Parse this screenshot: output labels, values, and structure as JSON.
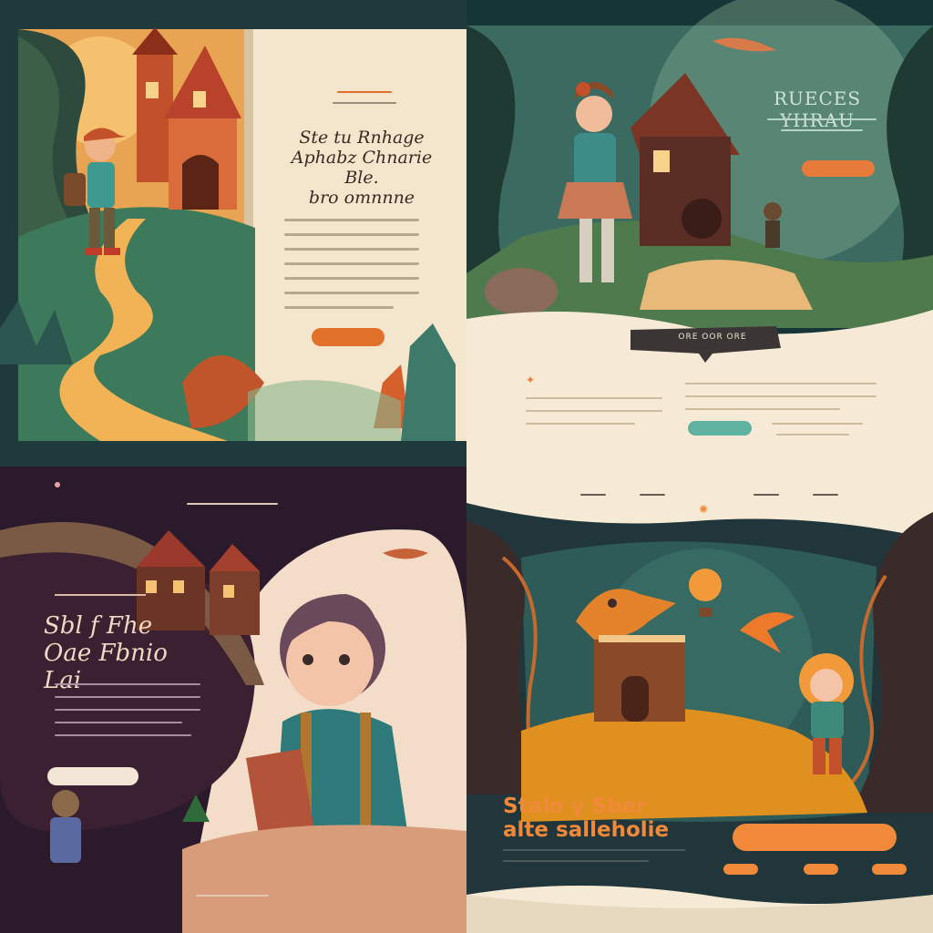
{
  "panels": [
    {
      "id": "top-left",
      "title_line1": "Ste tu Rnhage",
      "title_line2": "Aphabz Chnarie Ble.",
      "title_line3": "bro omnnne",
      "button": "",
      "colors": {
        "accent": "#e0702a",
        "paper": "#f4e6cc"
      }
    },
    {
      "id": "top-right",
      "title": "RUECES YHRAU",
      "sign": "ORE OOR ORE",
      "button": "",
      "colors": {
        "accent": "#e77b3a",
        "teal": "#5fb3a0"
      }
    },
    {
      "id": "bottom-left",
      "title_line1": "Sbl f Fhe",
      "title_line2": "Oae Fbnio Lai",
      "button": "",
      "colors": {
        "accent": "#e7a3a7",
        "bg": "#2a1a2c"
      }
    },
    {
      "id": "bottom-right",
      "title_line1": "Stalo y Sber",
      "title_line2": "alte salleholie",
      "button": "",
      "colors": {
        "accent": "#f08a3a",
        "bg": "#21363a"
      }
    }
  ]
}
